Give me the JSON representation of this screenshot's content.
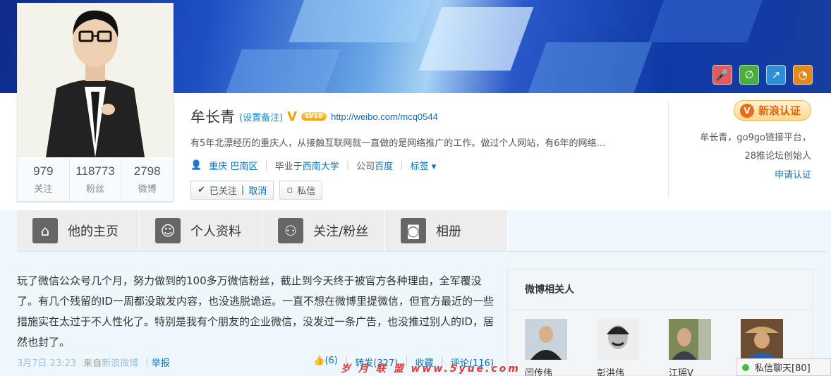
{
  "profile": {
    "name": "牟长青",
    "remark": "(设置备注)",
    "level": "LV18",
    "url": "http://weibo.com/mcq0544",
    "bio": "有5年北漂经历的重庆人，从接触互联网就一直做的是网络推广的工作。做过个人网站，有6年的网络…",
    "location": "重庆 巴南区",
    "edu_prefix": "毕业于",
    "school": "西南大学",
    "company_prefix": "公司",
    "company": "百度",
    "tags_label": "标签",
    "following_btn": "已关注",
    "cancel": "取消",
    "message_btn": "私信"
  },
  "counts": [
    {
      "num": "979",
      "label": "关注"
    },
    {
      "num": "118773",
      "label": "粉丝"
    },
    {
      "num": "2798",
      "label": "微博"
    }
  ],
  "verify": {
    "badge": "新浪认证",
    "desc_line1": "牟长青，go9go链接平台，",
    "desc_line2": "28推论坛创始人",
    "apply": "申请认证"
  },
  "tabs": [
    {
      "label": "他的主页",
      "icon": "house-icon"
    },
    {
      "label": "个人资料",
      "icon": "person-icon"
    },
    {
      "label": "关注/粉丝",
      "icon": "people-icon"
    },
    {
      "label": "相册",
      "icon": "camera-icon"
    }
  ],
  "post": {
    "text": "玩了微信公众号几个月，努力做到的100多万微信粉丝，截止到今天终于被官方各种理由，全军覆没了。有几个残留的ID一周都没敢发内容，也没逃脱诡运。一直不想在微博里提微信，但官方最近的一些措施实在太过于不人性化了。特别是我有个朋友的企业微信，没发过一条广告，也没推过别人的ID，居然也封了。",
    "time": "3月7日 23:23",
    "from_prefix": "来自",
    "source": "新浪微博",
    "report": "举报",
    "likes": "(6)",
    "repost": "转发(327)",
    "favorite": "收藏",
    "comment": "评论(116)"
  },
  "related": {
    "title": "微博相关人",
    "people": [
      "闫传伟",
      "彭洪伟",
      "江瑶V",
      ""
    ]
  },
  "watermark": "岁 月 联 盟   www.5yue.com",
  "chat": "私信聊天[80]"
}
